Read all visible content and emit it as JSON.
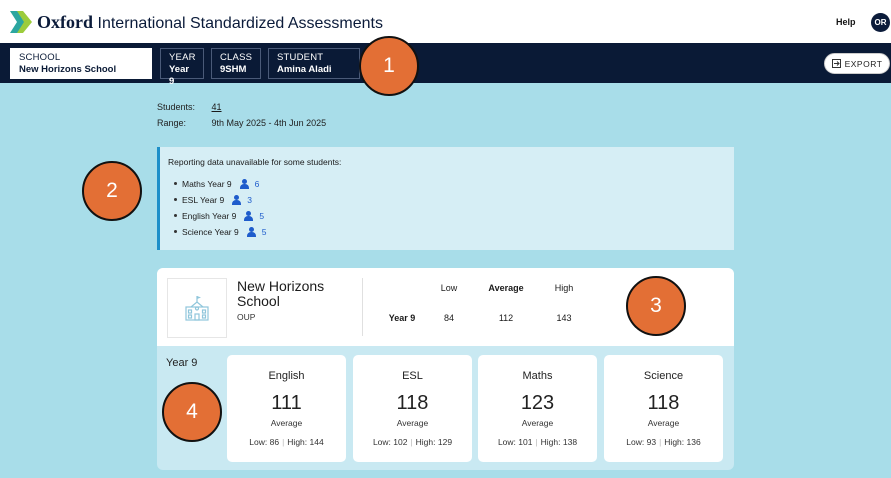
{
  "header": {
    "brand_bold": "Oxford",
    "brand_rest": "International Standardized Assessments",
    "help_label": "Help",
    "avatar_initials": "OR"
  },
  "filters": {
    "school": {
      "label": "SCHOOL",
      "value": "New Horizons School"
    },
    "year": {
      "label": "YEAR",
      "value": "Year 9"
    },
    "class": {
      "label": "CLASS",
      "value": "9SHM"
    },
    "student": {
      "label": "STUDENT",
      "value": "Amina Aladi"
    }
  },
  "export_label": "EXPORT",
  "meta": {
    "students_label": "Students:",
    "students_value": "41",
    "range_label": "Range:",
    "range_value": "9th May 2025 - 4th Jun 2025"
  },
  "notice": {
    "title": "Reporting data unavailable for some students:",
    "items": [
      {
        "subject": "Maths Year 9",
        "count": "6"
      },
      {
        "subject": "ESL Year 9",
        "count": "3"
      },
      {
        "subject": "English Year 9",
        "count": "5"
      },
      {
        "subject": "Science Year 9",
        "count": "5"
      }
    ]
  },
  "summary": {
    "school_name": "New Horizons School",
    "school_sub": "OUP",
    "headers": {
      "low": "Low",
      "average": "Average",
      "high": "High"
    },
    "row_label": "Year 9",
    "low": "84",
    "average": "112",
    "high": "143",
    "year_label": "Year 9"
  },
  "subjects": [
    {
      "name": "English",
      "average": "111",
      "avg_label": "Average",
      "low_text": "Low: 86",
      "high_text": "High: 144"
    },
    {
      "name": "ESL",
      "average": "118",
      "avg_label": "Average",
      "low_text": "Low: 102",
      "high_text": "High: 129"
    },
    {
      "name": "Maths",
      "average": "123",
      "avg_label": "Average",
      "low_text": "Low: 101",
      "high_text": "High: 138"
    },
    {
      "name": "Science",
      "average": "118",
      "avg_label": "Average",
      "low_text": "Low: 93",
      "high_text": "High: 136"
    }
  ],
  "callouts": [
    "1",
    "2",
    "3",
    "4"
  ],
  "colors": {
    "navbar": "#0a1a36",
    "background": "#a8dde9",
    "accent_blue": "#1e5ccc",
    "callout": "#e36f35"
  }
}
